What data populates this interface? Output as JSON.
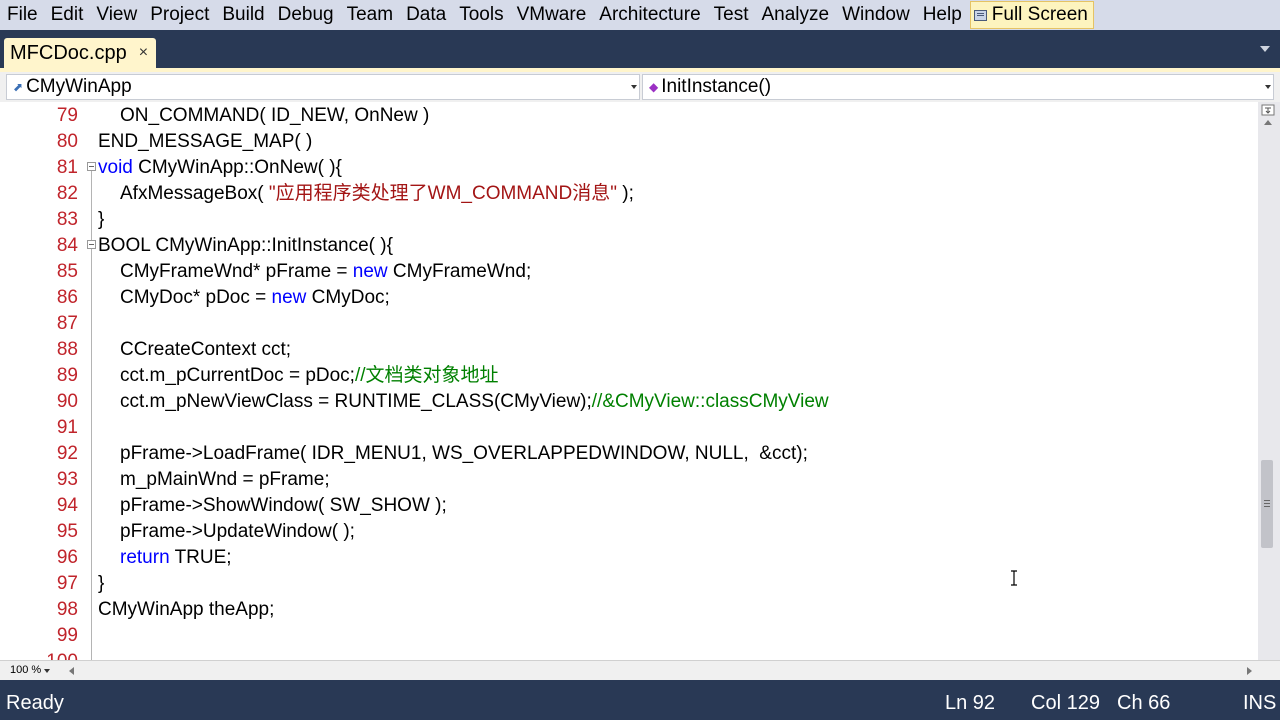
{
  "menu": [
    "File",
    "Edit",
    "View",
    "Project",
    "Build",
    "Debug",
    "Team",
    "Data",
    "Tools",
    "VMware",
    "Architecture",
    "Test",
    "Analyze",
    "Window",
    "Help"
  ],
  "fullscreen_label": "Full Screen",
  "tab": {
    "label": "MFCDoc.cpp",
    "close": "×"
  },
  "nav": {
    "class_scope": "CMyWinApp",
    "member": "InitInstance()"
  },
  "code_lines": [
    {
      "num": "79",
      "fold": false,
      "indent": 1,
      "tokens": [
        {
          "t": "ON_COMMAND( ID_NEW, OnNew )"
        }
      ]
    },
    {
      "num": "80",
      "fold": false,
      "indent": 0,
      "tokens": [
        {
          "t": "END_MESSAGE_MAP( )"
        }
      ]
    },
    {
      "num": "81",
      "fold": true,
      "indent": 0,
      "tokens": [
        {
          "t": "void",
          "c": "kw"
        },
        {
          "t": " CMyWinApp::OnNew( ){"
        }
      ]
    },
    {
      "num": "82",
      "fold": false,
      "indent": 1,
      "tokens": [
        {
          "t": "AfxMessageBox( "
        },
        {
          "t": "\"应用程序类处理了WM_COMMAND消息\"",
          "c": "str"
        },
        {
          "t": " );"
        }
      ]
    },
    {
      "num": "83",
      "fold": false,
      "indent": 0,
      "tokens": [
        {
          "t": "}"
        }
      ]
    },
    {
      "num": "84",
      "fold": true,
      "indent": 0,
      "tokens": [
        {
          "t": "BOOL CMyWinApp::InitInstance( ){"
        }
      ]
    },
    {
      "num": "85",
      "fold": false,
      "indent": 1,
      "tokens": [
        {
          "t": "CMyFrameWnd* pFrame = "
        },
        {
          "t": "new",
          "c": "kw"
        },
        {
          "t": " CMyFrameWnd;"
        }
      ]
    },
    {
      "num": "86",
      "fold": false,
      "indent": 1,
      "tokens": [
        {
          "t": "CMyDoc* pDoc = "
        },
        {
          "t": "new",
          "c": "kw"
        },
        {
          "t": " CMyDoc;"
        }
      ]
    },
    {
      "num": "87",
      "fold": false,
      "indent": 1,
      "tokens": []
    },
    {
      "num": "88",
      "fold": false,
      "indent": 1,
      "tokens": [
        {
          "t": "CCreateContext cct;"
        }
      ]
    },
    {
      "num": "89",
      "fold": false,
      "indent": 1,
      "tokens": [
        {
          "t": "cct.m_pCurrentDoc = pDoc;"
        },
        {
          "t": "//文档类对象地址",
          "c": "cmt"
        }
      ]
    },
    {
      "num": "90",
      "fold": false,
      "indent": 1,
      "tokens": [
        {
          "t": "cct.m_pNewViewClass = RUNTIME_CLASS(CMyView);"
        },
        {
          "t": "//&CMyView::classCMyView",
          "c": "cmt"
        }
      ]
    },
    {
      "num": "91",
      "fold": false,
      "indent": 1,
      "tokens": []
    },
    {
      "num": "92",
      "fold": false,
      "indent": 1,
      "tokens": [
        {
          "t": "pFrame->LoadFrame( IDR_MENU1, WS_OVERLAPPEDWINDOW, NULL,  &cct);"
        }
      ]
    },
    {
      "num": "93",
      "fold": false,
      "indent": 1,
      "tokens": [
        {
          "t": "m_pMainWnd = pFrame;"
        }
      ]
    },
    {
      "num": "94",
      "fold": false,
      "indent": 1,
      "tokens": [
        {
          "t": "pFrame->ShowWindow( SW_SHOW );"
        }
      ]
    },
    {
      "num": "95",
      "fold": false,
      "indent": 1,
      "tokens": [
        {
          "t": "pFrame->UpdateWindow( );"
        }
      ]
    },
    {
      "num": "96",
      "fold": false,
      "indent": 1,
      "tokens": [
        {
          "t": "return",
          "c": "kw"
        },
        {
          "t": " TRUE;"
        }
      ]
    },
    {
      "num": "97",
      "fold": false,
      "indent": 0,
      "tokens": [
        {
          "t": "}"
        }
      ]
    },
    {
      "num": "98",
      "fold": false,
      "indent": 0,
      "tokens": [
        {
          "t": "CMyWinApp theApp;"
        }
      ]
    },
    {
      "num": "99",
      "fold": false,
      "indent": 0,
      "tokens": []
    },
    {
      "num": "100",
      "fold": false,
      "indent": 0,
      "tokens": []
    }
  ],
  "zoom": "100 %",
  "status": {
    "ready": "Ready",
    "line": "Ln 92",
    "col": "Col 129",
    "ch": "Ch 66",
    "mode": "INS"
  },
  "icons": {
    "fullscreen": "fullscreen-icon",
    "tab_close": "close-icon",
    "class_scope": "class-icon",
    "member": "method-icon",
    "cursor": "ibeam-cursor-icon"
  },
  "colors": {
    "chrome": "#293955",
    "menubar": "#d6dbe9",
    "tab_active": "#fff5cc",
    "line_number": "#c0242b",
    "keyword": "#0000ff",
    "string": "#a31515",
    "comment": "#008000"
  }
}
